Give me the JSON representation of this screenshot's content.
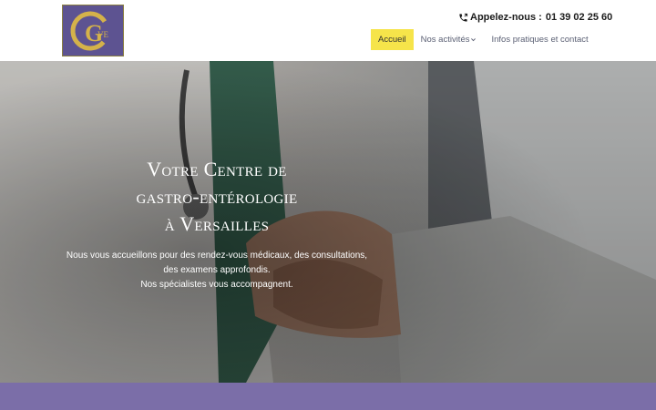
{
  "header": {
    "logo_text": "CVE",
    "phone_label": "Appelez-nous :",
    "phone_number": "01 39 02 25 60",
    "nav": [
      {
        "label": "Accueil",
        "active": true
      },
      {
        "label": "Nos activités",
        "dropdown": true
      },
      {
        "label": "Infos pratiques et contact"
      }
    ]
  },
  "hero": {
    "title_lines": [
      "Votre Centre de",
      "gastro-entérologie",
      "à Versailles"
    ],
    "text_lines": [
      "Nous vous accueillons pour des rendez-vous médicaux, des consultations,",
      "des examens approfondis.",
      "Nos spécialistes vous accompagnent."
    ]
  },
  "colors": {
    "accent_yellow": "#f6e44a",
    "band_purple": "#7b6ea8",
    "logo_purple": "#5d5391",
    "logo_gold": "#d4b24a"
  },
  "icons": [
    "logo-emblem",
    "phone-icon",
    "chevron-down-icon"
  ]
}
